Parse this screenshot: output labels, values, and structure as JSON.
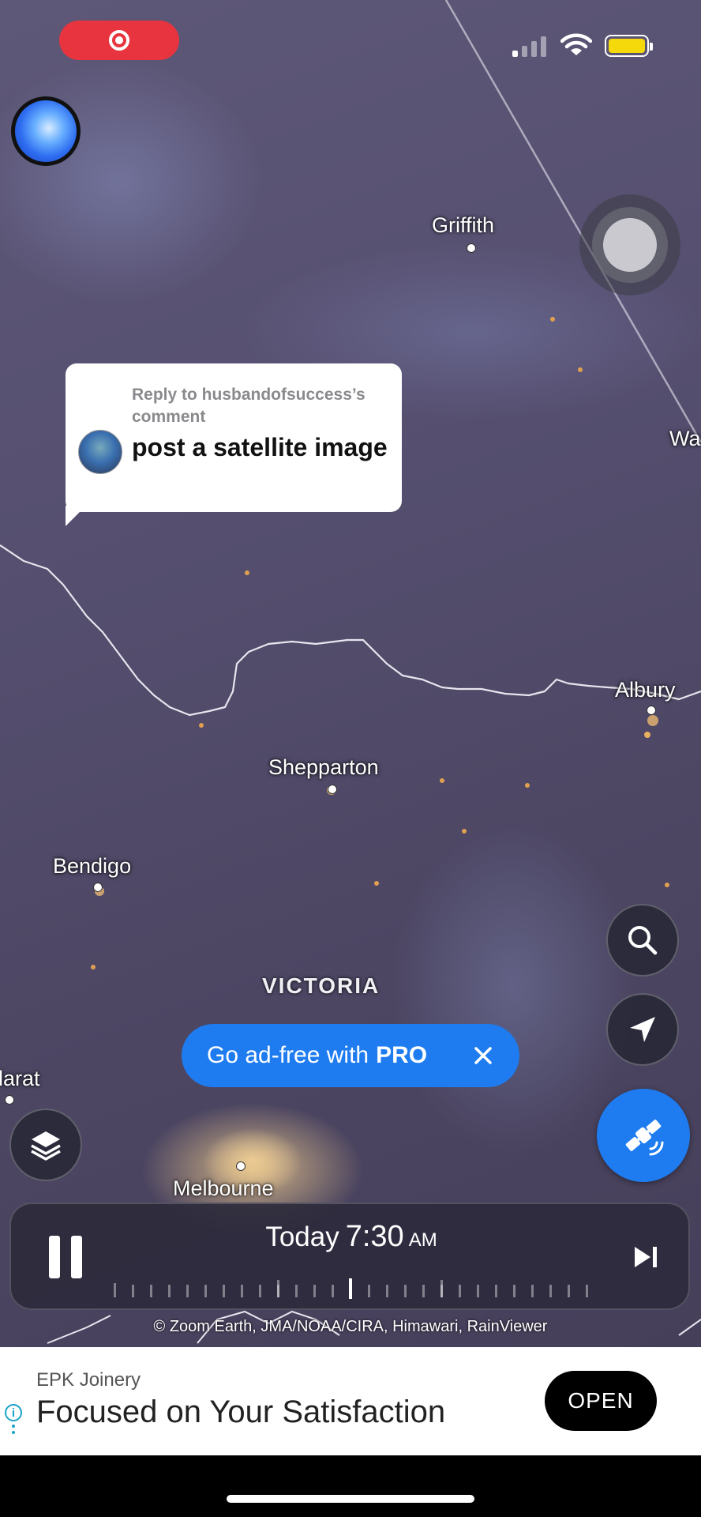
{
  "status_bar": {
    "record_icon": "screen-record-icon",
    "battery_color": "#f5d90a"
  },
  "map": {
    "cities": [
      {
        "name": "Griffith"
      },
      {
        "name": "Wa"
      },
      {
        "name": "Albury"
      },
      {
        "name": "Shepparton"
      },
      {
        "name": "Bendigo"
      },
      {
        "name": "larat"
      },
      {
        "name": "Melbourne"
      }
    ],
    "region_label": "VICTORIA"
  },
  "reply_bubble": {
    "context": "Reply to husbandofsuccess’s comment",
    "message": "post a satellite image"
  },
  "promo": {
    "text": "Go ad-free with",
    "highlight": "PRO"
  },
  "player": {
    "day": "Today",
    "time": "7:30",
    "ampm": "AM"
  },
  "attribution": "© Zoom Earth, JMA/NOAA/CIRA, Himawari, RainViewer",
  "ad": {
    "brand": "EPK Joinery",
    "headline": "Focused on Your Satisfaction",
    "cta": "OPEN",
    "info": "i"
  },
  "colors": {
    "accent": "#1e7cf0",
    "record": "#e8343e"
  }
}
